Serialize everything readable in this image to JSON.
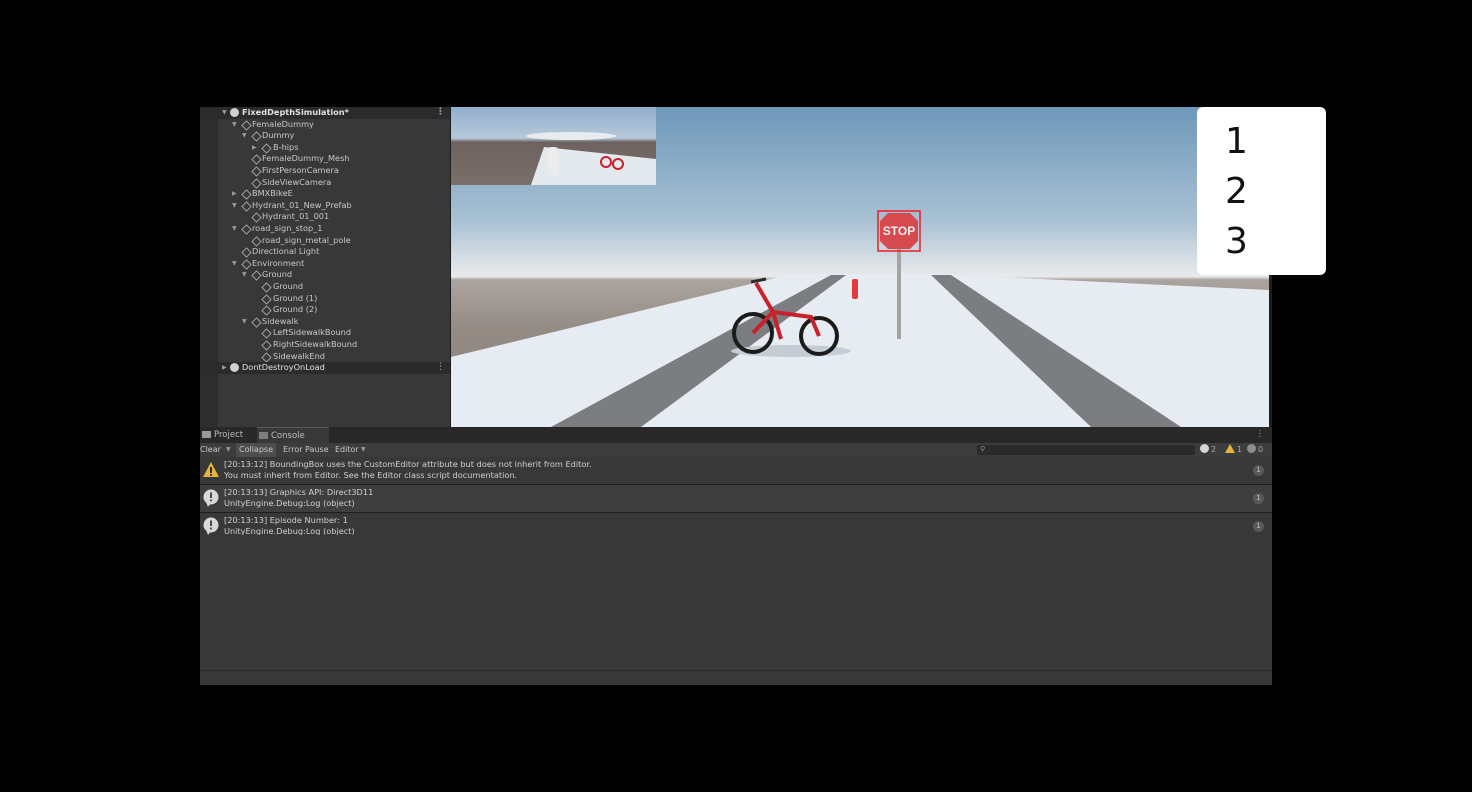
{
  "hierarchy": {
    "scene": "FixedDepthSimulation*",
    "items": [
      "FemaleDummy",
      "Dummy",
      "B-hips",
      "FemaleDummy_Mesh",
      "FirstPersonCamera",
      "SideViewCamera",
      "BMXBikeE",
      "Hydrant_01_New_Prefab",
      "Hydrant_01_001",
      "road_sign_stop_1",
      "road_sign_metal_pole",
      "Directional Light",
      "Environment",
      "Ground",
      "Ground",
      "Ground (1)",
      "Ground (2)",
      "Sidewalk",
      "LeftSidewalkBound",
      "RightSidewalkBound",
      "SidewalkEnd"
    ],
    "dont_destroy": "DontDestroyOnLoad"
  },
  "game_view": {
    "stop_sign_text": "STOP",
    "overlay_numbers": [
      "1",
      "2",
      "3"
    ]
  },
  "console": {
    "tabs": [
      "Project",
      "Console"
    ],
    "toolbar": {
      "clear": "Clear",
      "collapse": "Collapse",
      "error_pause": "Error Pause",
      "editor": "Editor"
    },
    "counts": {
      "info": "2",
      "warnings": "1",
      "errors": "0"
    },
    "messages": [
      {
        "type": "warning",
        "line1": "[20:13:12] BoundingBox uses the CustomEditor attribute but does not inherit from Editor.",
        "line2": "You must inherit from Editor. See the Editor class script documentation.",
        "count": "1"
      },
      {
        "type": "info",
        "line1": "[20:13:13] Graphics API: Direct3D11",
        "line2": "UnityEngine.Debug:Log (object)",
        "count": "1"
      },
      {
        "type": "info",
        "line1": "[20:13:13] Episode Number: 1",
        "line2": "UnityEngine.Debug:Log (object)",
        "count": "1"
      }
    ]
  },
  "colors": {
    "panel": "#383838",
    "warning": "#e5b43c",
    "bike": "#c8212b"
  }
}
